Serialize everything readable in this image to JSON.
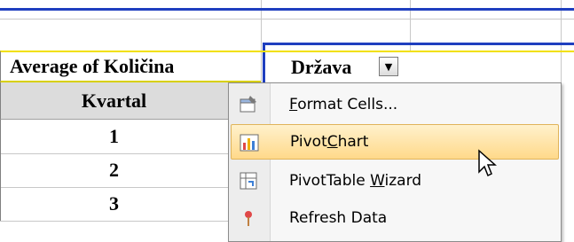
{
  "pivot": {
    "data_field": "Average of Količina",
    "column_field": "Država",
    "row_field": "Kvartal",
    "rows": [
      "1",
      "2",
      "3"
    ]
  },
  "context_menu": {
    "items": [
      {
        "label_pre": "",
        "label_key": "F",
        "label_post": "ormat Cells...",
        "icon": "format-cells-icon"
      },
      {
        "label_pre": "Pivot",
        "label_key": "C",
        "label_post": "hart",
        "icon": "pivotchart-icon",
        "highlighted": true
      },
      {
        "label_pre": "PivotTable ",
        "label_key": "W",
        "label_post": "izard",
        "icon": "pivottable-wizard-icon"
      },
      {
        "label_pre": "Refresh Data",
        "label_key": "",
        "label_post": "",
        "icon": "refresh-data-icon"
      }
    ]
  },
  "colors": {
    "highlight": "#ffd98a",
    "header_fill": "#dcdcdc",
    "selection_blue": "#1f3fbf",
    "selection_yellow": "#f2e000"
  }
}
